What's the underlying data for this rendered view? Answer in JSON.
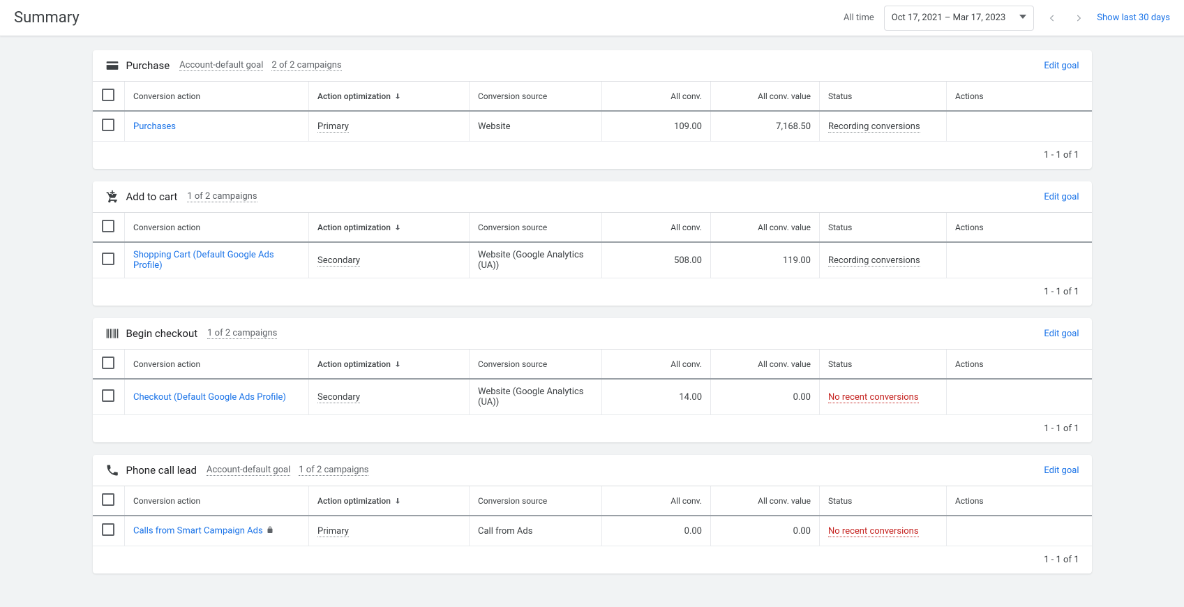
{
  "topbar": {
    "title": "Summary",
    "all_time": "All time",
    "date_range": "Oct 17, 2021 – Mar 17, 2023",
    "show_last": "Show last 30 days"
  },
  "columns": {
    "conversion_action": "Conversion action",
    "action_optimization": "Action optimization",
    "conversion_source": "Conversion source",
    "all_conv": "All conv.",
    "all_conv_value": "All conv. value",
    "status": "Status",
    "actions": "Actions"
  },
  "edit_goal": "Edit goal",
  "sections": [
    {
      "icon": "credit-card-icon",
      "title": "Purchase",
      "meta": [
        "Account-default goal",
        "2 of 2 campaigns"
      ],
      "rows": [
        {
          "name": "Purchases",
          "opt": "Primary",
          "src": "Website",
          "conv": "109.00",
          "val": "7,168.50",
          "status": "Recording conversions",
          "status_warn": false,
          "locked": false
        }
      ],
      "footer": "1 - 1 of 1"
    },
    {
      "icon": "add-cart-icon",
      "title": "Add to cart",
      "meta": [
        "1 of 2 campaigns"
      ],
      "rows": [
        {
          "name": "Shopping Cart (Default Google Ads Profile)",
          "opt": "Secondary",
          "src": "Website (Google Analytics (UA))",
          "conv": "508.00",
          "val": "119.00",
          "status": "Recording conversions",
          "status_warn": false,
          "locked": false
        }
      ],
      "footer": "1 - 1 of 1"
    },
    {
      "icon": "barcode-icon",
      "title": "Begin checkout",
      "meta": [
        "1 of 2 campaigns"
      ],
      "rows": [
        {
          "name": "Checkout (Default Google Ads Profile)",
          "opt": "Secondary",
          "src": "Website (Google Analytics (UA))",
          "conv": "14.00",
          "val": "0.00",
          "status": "No recent conversions",
          "status_warn": true,
          "locked": false
        }
      ],
      "footer": "1 - 1 of 1"
    },
    {
      "icon": "phone-icon",
      "title": "Phone call lead",
      "meta": [
        "Account-default goal",
        "1 of 2 campaigns"
      ],
      "rows": [
        {
          "name": "Calls from Smart Campaign Ads",
          "opt": "Primary",
          "src": "Call from Ads",
          "conv": "0.00",
          "val": "0.00",
          "status": "No recent conversions",
          "status_warn": true,
          "locked": true
        }
      ],
      "footer": "1 - 1 of 1"
    }
  ]
}
